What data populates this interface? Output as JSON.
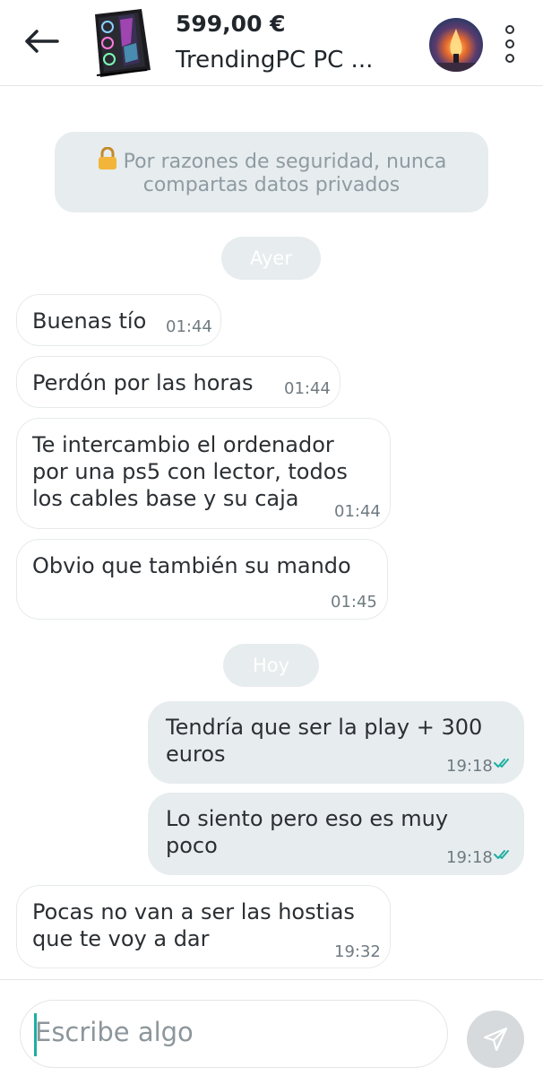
{
  "header": {
    "price": "599,00 €",
    "title": "TrendingPC PC ..."
  },
  "notice": {
    "text": "Por razones de seguridad, nunca compartas datos privados",
    "icon": "lock-icon"
  },
  "days": {
    "yesterday": "Ayer",
    "today": "Hoy"
  },
  "messages": [
    {
      "direction": "in",
      "text": "Buenas tío",
      "time": "01:44"
    },
    {
      "direction": "in",
      "text": "Perdón por las horas",
      "time": "01:44"
    },
    {
      "direction": "in",
      "lines": [
        "Te intercambio el ordenador",
        "por una ps5 con lector, todos",
        "los cables base y su caja"
      ],
      "time": "01:44"
    },
    {
      "direction": "in",
      "text": "Obvio que también su mando",
      "time": "01:45"
    },
    {
      "direction": "out",
      "lines": [
        "Tendría que ser la play + 300",
        "euros"
      ],
      "time": "19:18",
      "status": "read"
    },
    {
      "direction": "out",
      "lines": [
        "Lo siento pero eso es muy",
        "poco"
      ],
      "time": "19:18",
      "status": "read"
    },
    {
      "direction": "in",
      "lines": [
        "Pocas no van a ser las hostias",
        "que te voy a dar"
      ],
      "time": "19:32"
    }
  ],
  "input": {
    "placeholder": "Escribe algo"
  },
  "colors": {
    "accent": "#1dafa0",
    "bubble_out": "#e7ecee",
    "bubble_in": "#ffffff",
    "pill": "#e7ecee"
  }
}
